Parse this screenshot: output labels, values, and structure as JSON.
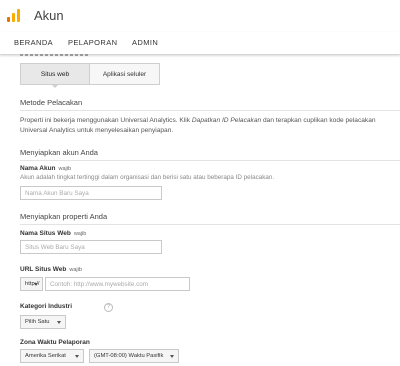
{
  "app": {
    "title": "Akun",
    "brand_colors": [
      "#f9ab00",
      "#e37400"
    ]
  },
  "nav": {
    "items": [
      "BERANDA",
      "PELAPORAN",
      "ADMIN"
    ]
  },
  "tracking_target": {
    "options": [
      "Situs web",
      "Aplikasi seluler"
    ],
    "selected": "Situs web"
  },
  "tracking_method": {
    "heading": "Metode Pelacakan",
    "text_before": "Properti ini bekerja menggunakan Universal Analytics. Klik ",
    "text_link": "Dapatkan ID Pelacakan",
    "text_after": " dan terapkan cuplikan kode pelacakan Universal Analytics untuk menyelesaikan penyiapan."
  },
  "account_setup": {
    "heading": "Menyiapkan akun Anda",
    "field_label": "Nama Akun",
    "required_label": "wajib",
    "help_text": "Akun adalah tingkat tertinggi dalam organisasi dan berisi satu atau beberapa ID pelacakan.",
    "placeholder": "Nama Akun Baru Saya",
    "value": ""
  },
  "property_setup": {
    "heading": "Menyiapkan properti Anda",
    "site_name": {
      "label": "Nama Situs Web",
      "required_label": "wajib",
      "placeholder": "Situs Web Baru Saya",
      "value": ""
    },
    "site_url": {
      "label": "URL Situs Web",
      "required_label": "wajib",
      "protocol": "http://",
      "placeholder": "Contoh: http://www.mywebsite.com",
      "value": ""
    },
    "industry": {
      "label": "Kategori Industri",
      "help_icon": "question-icon",
      "selected": "Pilih Satu"
    },
    "timezone": {
      "label": "Zona Waktu Pelaporan",
      "country": "Amerika Serikat",
      "zone": "(GMT-08:00) Waktu Pasifik"
    }
  }
}
